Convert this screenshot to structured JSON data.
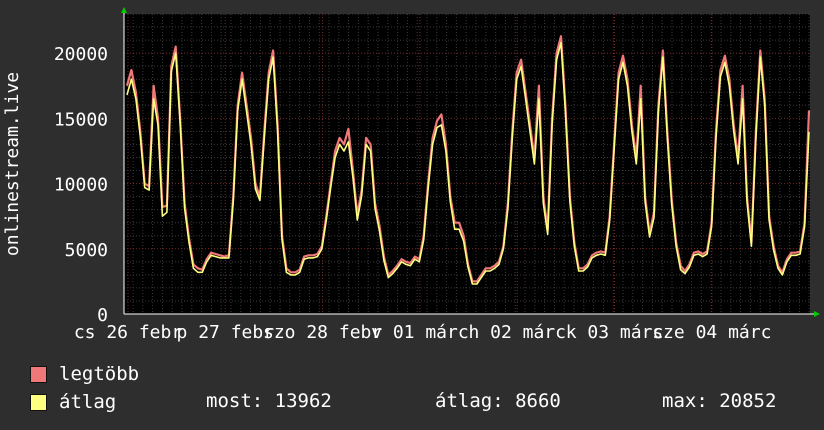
{
  "chart_data": {
    "type": "line",
    "ylabel": "onlinestream.live",
    "ylim": [
      0,
      23000
    ],
    "yticks": [
      0,
      5000,
      10000,
      15000,
      20000
    ],
    "grid": true,
    "xtick_labels": [
      "cs 26 febr",
      "p 27 febr",
      "szo 28 febr",
      "v 01 márc",
      "h 02 márc",
      "k 03 márc",
      "sze 04 márc"
    ],
    "series": [
      {
        "name": "legtöbb",
        "color": "#f07878",
        "values": [
          17500,
          18700,
          17000,
          14000,
          10000,
          9800,
          17500,
          15000,
          8200,
          8300,
          19000,
          20500,
          15000,
          8500,
          5800,
          3800,
          3500,
          3400,
          4200,
          4700,
          4600,
          4500,
          4400,
          4500,
          9000,
          16000,
          18500,
          16000,
          13500,
          10000,
          9000,
          14000,
          18500,
          20200,
          14500,
          6000,
          3500,
          3200,
          3200,
          3400,
          4400,
          4500,
          4500,
          4600,
          5200,
          7500,
          10000,
          12500,
          13500,
          13000,
          14200,
          11000,
          7600,
          9500,
          13500,
          13000,
          8500,
          6800,
          4400,
          3000,
          3300,
          3700,
          4200,
          4000,
          3900,
          4400,
          4200,
          6000,
          10000,
          13500,
          14800,
          15300,
          13000,
          9000,
          7000,
          7000,
          6000,
          3800,
          2500,
          2500,
          3000,
          3500,
          3500,
          3700,
          4000,
          5200,
          8500,
          14000,
          18500,
          19500,
          17000,
          14500,
          12000,
          17500,
          9000,
          6500,
          15000,
          20000,
          21300,
          16000,
          9000,
          5500,
          3500,
          3500,
          3800,
          4500,
          4700,
          4800,
          4700,
          7500,
          13000,
          18500,
          19800,
          18000,
          14500,
          12000,
          17500,
          9000,
          6200,
          7800,
          16000,
          20200,
          14000,
          8800,
          5500,
          3700,
          3300,
          3800,
          4700,
          4800,
          4600,
          4800,
          7000,
          14000,
          18700,
          19800,
          18000,
          14500,
          12000,
          17500,
          9000,
          5500,
          14000,
          20200,
          16500,
          7500,
          5200,
          3700,
          3200,
          4200,
          4700,
          4700,
          4800,
          7000,
          15600
        ]
      },
      {
        "name": "átlag",
        "color": "#ffff80",
        "values": [
          16800,
          18000,
          16500,
          13600,
          9700,
          9500,
          16500,
          14500,
          7500,
          7800,
          18600,
          20000,
          14700,
          8100,
          5500,
          3500,
          3200,
          3200,
          4000,
          4500,
          4400,
          4300,
          4300,
          4300,
          8700,
          15600,
          18000,
          15500,
          13000,
          9600,
          8700,
          13500,
          18000,
          19700,
          14000,
          5700,
          3200,
          3000,
          3000,
          3200,
          4200,
          4300,
          4300,
          4400,
          5000,
          7200,
          9700,
          12000,
          13000,
          12500,
          13200,
          10500,
          7200,
          9100,
          13000,
          12500,
          8100,
          6400,
          4100,
          2800,
          3100,
          3500,
          4000,
          3800,
          3700,
          4200,
          4000,
          5700,
          9600,
          13000,
          14300,
          14500,
          12500,
          8600,
          6500,
          6500,
          5600,
          3600,
          2300,
          2300,
          2800,
          3300,
          3300,
          3500,
          3800,
          5000,
          8100,
          13500,
          18000,
          19000,
          16500,
          14000,
          11500,
          16500,
          8500,
          6100,
          14500,
          19500,
          20800,
          15500,
          8600,
          5200,
          3300,
          3300,
          3600,
          4300,
          4500,
          4600,
          4500,
          7200,
          12600,
          18000,
          19300,
          17500,
          14000,
          11500,
          16500,
          8600,
          5900,
          7400,
          15500,
          19700,
          13500,
          8400,
          5200,
          3400,
          3100,
          3600,
          4500,
          4600,
          4400,
          4600,
          6700,
          13500,
          18200,
          19300,
          17500,
          14000,
          11500,
          16500,
          8600,
          5200,
          13500,
          19700,
          16000,
          7200,
          4900,
          3500,
          3000,
          4000,
          4500,
          4500,
          4600,
          6700,
          13962
        ]
      }
    ]
  },
  "stats": {
    "most": "most: 13962",
    "atlag": "átlag: 8660",
    "max": "max: 20852"
  }
}
